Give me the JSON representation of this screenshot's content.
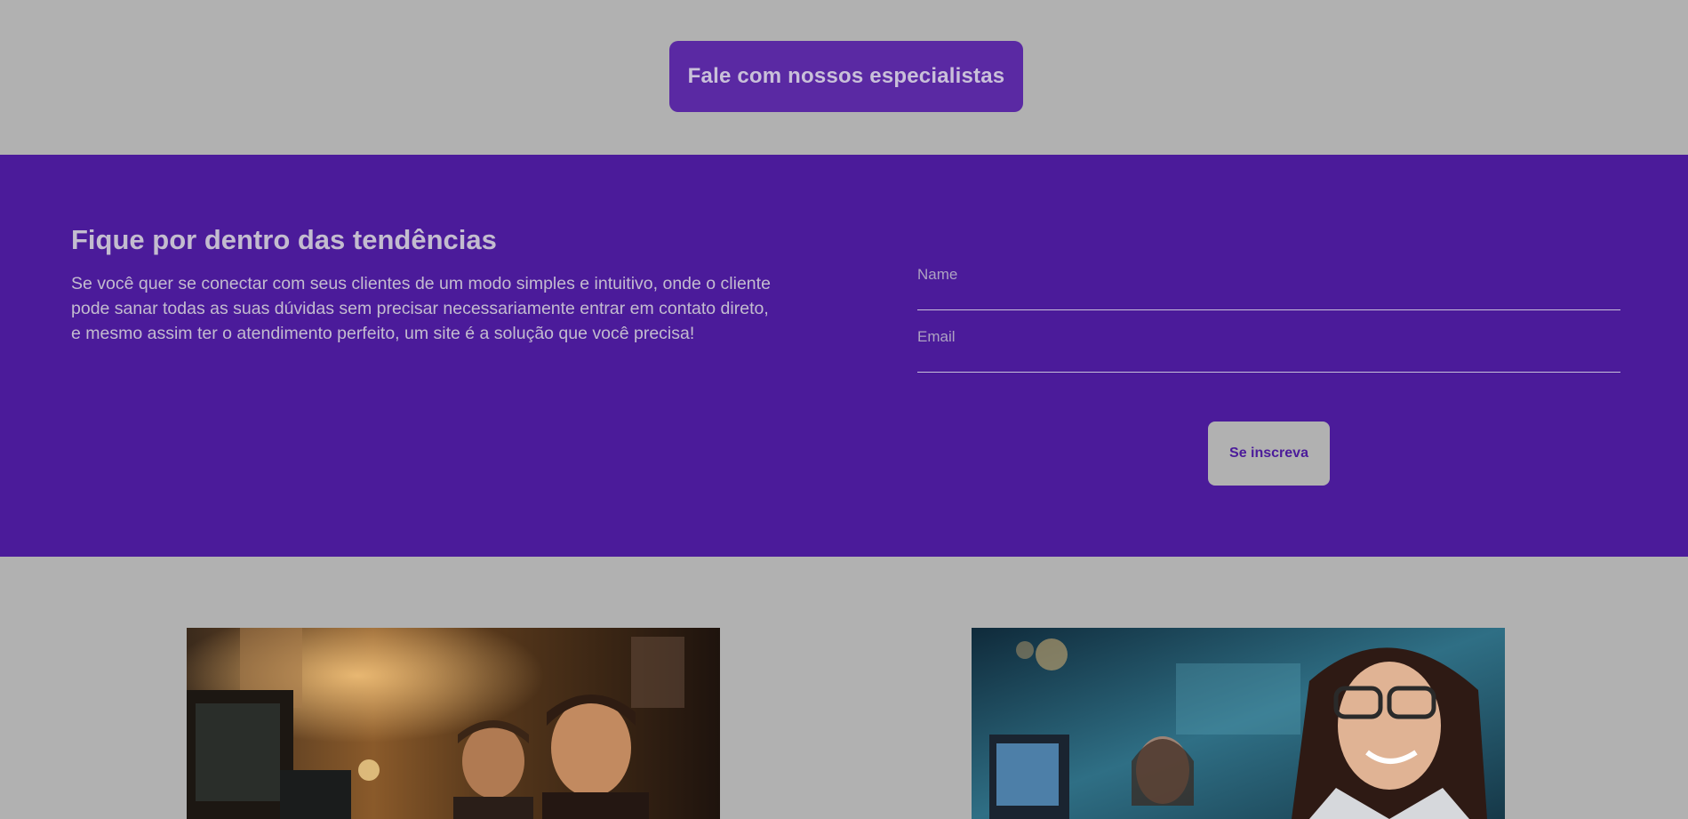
{
  "cta": {
    "label": "Fale com nossos especialistas"
  },
  "newsletter": {
    "title": "Fique por dentro das tendências",
    "description": "Se você quer se conectar com seus clientes de um modo simples e intuitivo, onde o cliente pode sanar todas as suas dúvidas sem precisar necessariamente entrar em contato direto, e mesmo assim ter o atendimento perfeito, um site é a solução que você precisa!",
    "form": {
      "name_placeholder": "Name",
      "email_placeholder": "Email",
      "submit_label": "Se inscreva"
    }
  },
  "gallery": {
    "images": [
      {
        "subject": "team-working-at-computers-photo"
      },
      {
        "subject": "smiling-support-agent-photo"
      }
    ]
  },
  "colors": {
    "page_background": "#b1b1b1",
    "newsletter_background": "#4b1b9a",
    "cta_button": "#5a29a3",
    "text_light": "#c3bccf"
  }
}
